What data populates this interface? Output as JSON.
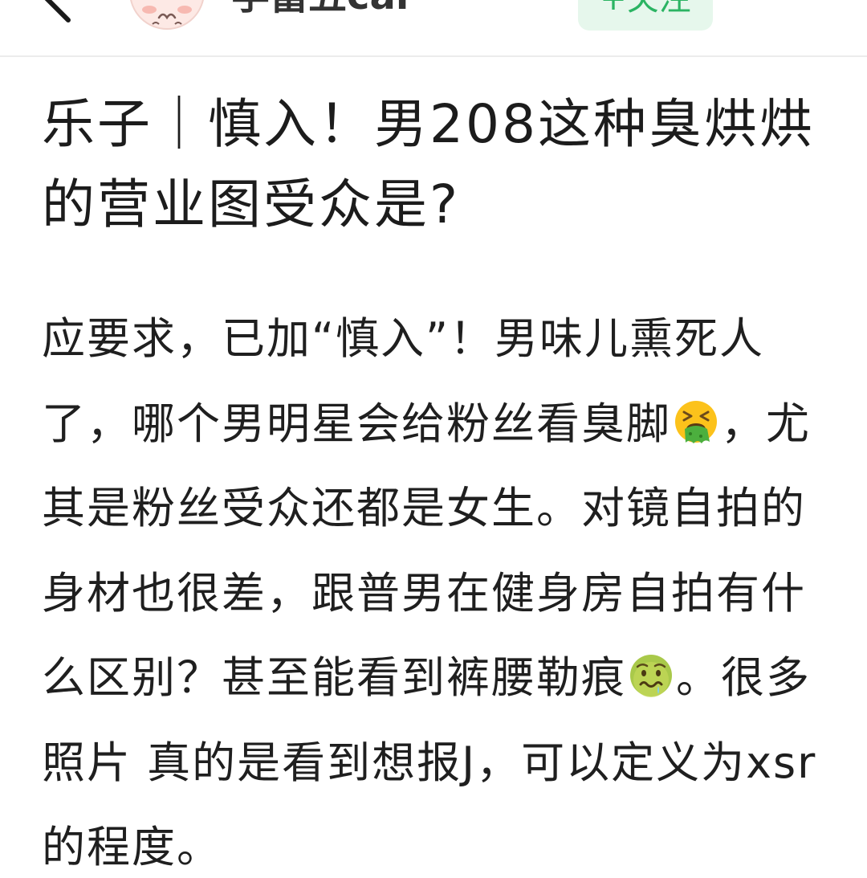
{
  "header": {
    "back_icon": "chevron-left-icon",
    "avatar_icon": "avatar",
    "username": "学富五car",
    "follow_label": "+关注"
  },
  "post": {
    "title_lines": [
      "乐子｜慎入！男208这种臭烘烘",
      "的营业图受众是?"
    ],
    "body_lines": [
      {
        "text": "应要求，已加“慎入”！男味儿熏死人"
      },
      {
        "text": "了，哪个男明星会给粉丝看臭脚",
        "emoji": "face-vomiting-icon",
        "after": "，尤"
      },
      {
        "text": "其是粉丝受众还都是女生。对镜自拍的"
      },
      {
        "text": "身材也很差，跟普男在健身房自拍有什"
      },
      {
        "text": "么区别？甚至能看到裤腰勒痕",
        "emoji": "nauseated-face-icon",
        "after": "。很多"
      },
      {
        "text": "照片 真的是看到想报J，可以定义为xsr"
      },
      {
        "text": "的程度。"
      }
    ]
  },
  "colors": {
    "text": "#1f1f1f",
    "follow_bg": "#e6f7ec",
    "follow_text": "#2bb463",
    "divider": "#ececec"
  }
}
